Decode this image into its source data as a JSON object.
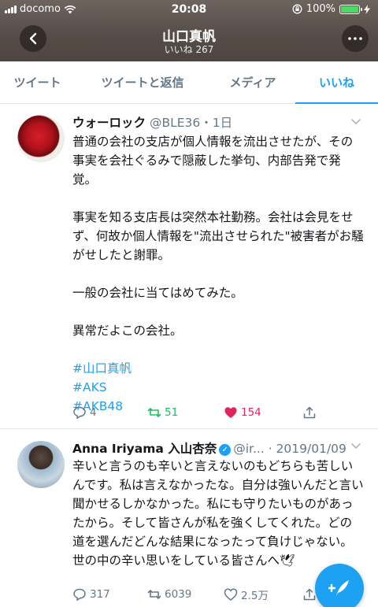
{
  "status_bar": {
    "carrier": "docomo",
    "time": "20:08",
    "battery": "100%",
    "battery_level": 1.0
  },
  "header": {
    "title": "山口真帆",
    "subtitle": "いいね 267",
    "back_icon": "chevron-left-icon",
    "more_icon": "more-icon"
  },
  "tabs": [
    {
      "label": "ツイート"
    },
    {
      "label": "ツイートと返信"
    },
    {
      "label": "メディア"
    },
    {
      "label": "いいね",
      "active": true
    }
  ],
  "tweets": [
    {
      "name": "ウォーロック",
      "handle": "@BLE36",
      "time": "・1日",
      "body": [
        "普通の会社の支店が個人情報を流出させたが、その事実を会社ぐるみで隠蔽した挙句、内部告発で発覚。",
        "事実を知る支店長は突然本社勤務。会社は会見をせず、何故か個人情報を\"流出させられた\"被害者がお騒がせしたと謝罪。",
        "一般の会社に当てはめてみた。",
        "異常だよこの会社。"
      ],
      "hashtags": [
        "#山口真帆",
        "#AKS",
        "#AKB48"
      ],
      "replies": "4",
      "retweets": "51",
      "likes": "154",
      "liked": true,
      "retweeted": true
    },
    {
      "name": "Anna Iriyama 入山杏奈",
      "handle": "@ir...",
      "time": "· 2019/01/09",
      "verified": true,
      "body": [
        "辛いと言うのも辛いと言えないのもどちらも苦しいんです。私は言えなかったな。自分は強いんだと言い聞かせるしかなかった。私にも守りたいものがあったから。そして皆さんが私を強くしてくれた。どの道を選んだどんな結果になったって負けじゃない。世の中の辛い思いをしている皆さんへ🕊"
      ],
      "replies": "317",
      "retweets": "6039",
      "likes": "2.5万"
    }
  ],
  "compose_button": {
    "icon": "compose-icon"
  },
  "colors": {
    "accent": "#1da1f2",
    "retweet": "#17bf63",
    "like": "#e0245e",
    "secondary_text": "#657786"
  }
}
